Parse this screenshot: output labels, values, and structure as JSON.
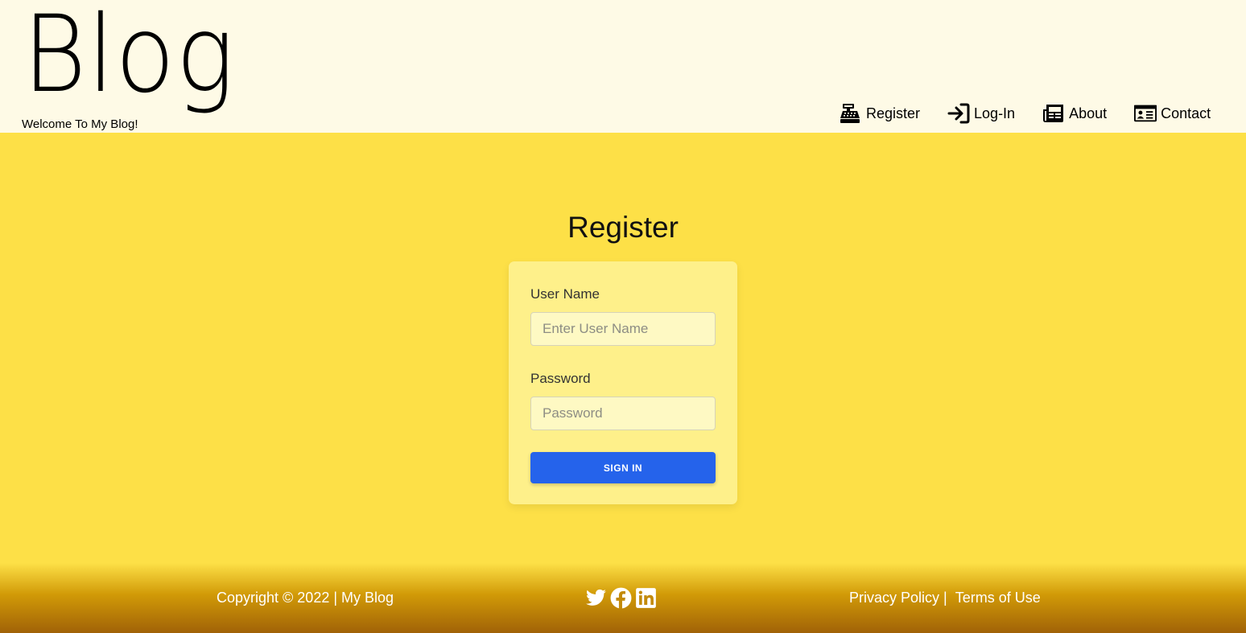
{
  "header": {
    "logo": "Blog",
    "tagline": "Welcome To My Blog!",
    "nav": [
      {
        "label": "Register",
        "icon": "cash-register-icon"
      },
      {
        "label": "Log-In",
        "icon": "login-arrow-icon"
      },
      {
        "label": "About",
        "icon": "newspaper-icon"
      },
      {
        "label": "Contact",
        "icon": "contact-card-icon"
      }
    ]
  },
  "main": {
    "title": "Register",
    "form": {
      "username_label": "User Name",
      "username_placeholder": "Enter User Name",
      "password_label": "Password",
      "password_placeholder": "Password",
      "submit_label": "SIGN IN"
    }
  },
  "footer": {
    "copyright": "Copyright © 2022 | My Blog",
    "socials": [
      "twitter-icon",
      "facebook-icon",
      "linkedin-icon"
    ],
    "privacy": "Privacy Policy",
    "separator": "|",
    "terms": "Terms of Use"
  },
  "colors": {
    "header_bg": "#fefae6",
    "page_bg": "#fde047",
    "card_bg": "#fef08a",
    "button_bg": "#2563eb",
    "footer_dark": "#a16207"
  }
}
